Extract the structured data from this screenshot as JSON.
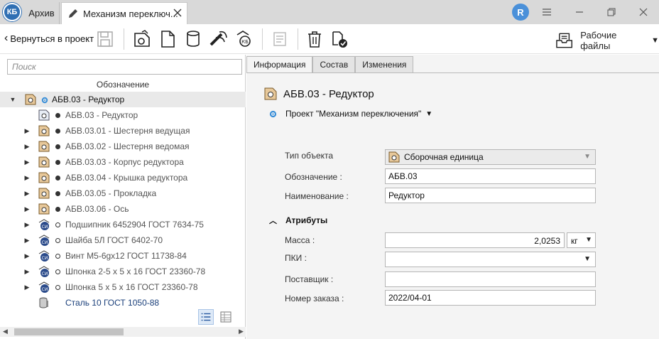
{
  "titlebar": {
    "logo_text": "КБ",
    "tab_archive": "Архив",
    "tab_active": "Механизм переключ...",
    "avatar_letter": "R"
  },
  "toolbar": {
    "back_label": "Вернуться в проект",
    "work_files_label": "Рабочие файлы"
  },
  "left_panel": {
    "search_placeholder": "Поиск",
    "column_header": "Обозначение",
    "tree": [
      {
        "label": "АБВ.03 - Редуктор",
        "icon": "assembly-icon",
        "marker": "gear",
        "expanded": true,
        "root": true
      },
      {
        "label": "АБВ.03 - Редуктор",
        "icon": "assembly-doc-icon",
        "marker": "filled-dot",
        "expandable": false
      },
      {
        "label": "АБВ.03.01 - Шестерня ведущая",
        "icon": "part-icon",
        "marker": "filled-dot",
        "expandable": true
      },
      {
        "label": "АБВ.03.02 - Шестерня ведомая",
        "icon": "part-icon",
        "marker": "filled-dot",
        "expandable": true
      },
      {
        "label": "АБВ.03.03 - Корпус редуктора",
        "icon": "part-icon",
        "marker": "filled-dot",
        "expandable": true
      },
      {
        "label": "АБВ.03.04 - Крышка редуктора",
        "icon": "part-icon",
        "marker": "filled-dot",
        "expandable": true
      },
      {
        "label": "АБВ.03.05 - Прокладка",
        "icon": "part-icon",
        "marker": "filled-dot",
        "expandable": true
      },
      {
        "label": "АБВ.03.06 - Ось",
        "icon": "part-icon",
        "marker": "filled-dot",
        "expandable": true
      },
      {
        "label": "Подшипник 6452904 ГОСТ 7634-75",
        "icon": "standard-part-icon",
        "marker": "hollow-dot",
        "expandable": true
      },
      {
        "label": "Шайба 5Л ГОСТ 6402-70",
        "icon": "standard-part-icon",
        "marker": "hollow-dot",
        "expandable": true
      },
      {
        "label": "Винт M5-6gx12 ГОСТ 11738-84",
        "icon": "standard-part-icon",
        "marker": "hollow-dot",
        "expandable": true
      },
      {
        "label": "Шпонка 2-5 x 5 x 16 ГОСТ 23360-78",
        "icon": "standard-part-icon",
        "marker": "hollow-dot",
        "expandable": true
      },
      {
        "label": "Шпонка 5 x 5 x 16 ГОСТ 23360-78",
        "icon": "standard-part-icon",
        "marker": "hollow-dot",
        "expandable": true
      },
      {
        "label": "Сталь 10 ГОСТ 1050-88",
        "icon": "material-icon",
        "marker": "none",
        "expandable": false
      }
    ]
  },
  "right_panel": {
    "tabs": [
      "Информация",
      "Состав",
      "Изменения"
    ],
    "active_tab": "Информация",
    "object_title": "АБВ.03 - Редуктор",
    "project_label": "Проект \"Механизм переключения\"",
    "fields": {
      "type_label": "Тип объекта",
      "type_value": "Сборочная единица",
      "designation_label": "Обозначение :",
      "designation_value": "АБВ.03",
      "name_label": "Наименование :",
      "name_value": "Редуктор"
    },
    "attributes": {
      "section_label": "Атрибуты",
      "mass_label": "Масса :",
      "mass_value": "2,0253",
      "mass_unit": "кг",
      "pki_label": "ПКИ :",
      "pki_value": "",
      "supplier_label": "Поставщик :",
      "supplier_value": "",
      "order_label": "Номер заказа :",
      "order_value": "2022/04-01"
    }
  },
  "colors": {
    "titlebar": "#d9d9d9",
    "accent": "#4a90d9",
    "selected_row": "#e9e9e9",
    "material_text": "#1a3f7a",
    "gear": "#3a8fd8"
  }
}
